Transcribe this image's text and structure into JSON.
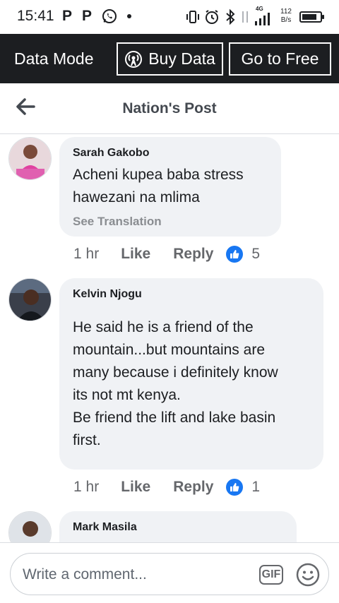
{
  "status_bar": {
    "time": "15:41",
    "left_icons": [
      "P",
      "P",
      "whatsapp-icon",
      "dot"
    ],
    "network": "4G",
    "speed_value": "112",
    "speed_unit": "B/s",
    "battery_level": 0.85
  },
  "data_bar": {
    "mode_label": "Data Mode",
    "buy_data_label": "Buy Data",
    "go_free_label": "Go to Free"
  },
  "header": {
    "title": "Nation's Post"
  },
  "comments": [
    {
      "author": "Sarah Gakobo",
      "text": "Acheni kupea baba stress\nhawezani na mlima",
      "see_translation": "See Translation",
      "time": "1 hr",
      "like_label": "Like",
      "reply_label": "Reply",
      "reactions": "5"
    },
    {
      "author": "Kelvin Njogu",
      "text": "He said he is a friend of the\nmountain...but mountains are\nmany because i definitely know\nits not mt kenya.\nBe friend the lift and lake basin\nfirst.",
      "time": "1 hr",
      "like_label": "Like",
      "reply_label": "Reply",
      "reactions": "1"
    },
    {
      "author": "Mark Masila"
    }
  ],
  "composer": {
    "placeholder": "Write a comment...",
    "gif_label": "GIF"
  },
  "colors": {
    "data_bar_bg": "#1c1e21",
    "bubble_bg": "#f0f2f5",
    "reaction_blue": "#1877f2",
    "meta_gray": "#65676b"
  }
}
